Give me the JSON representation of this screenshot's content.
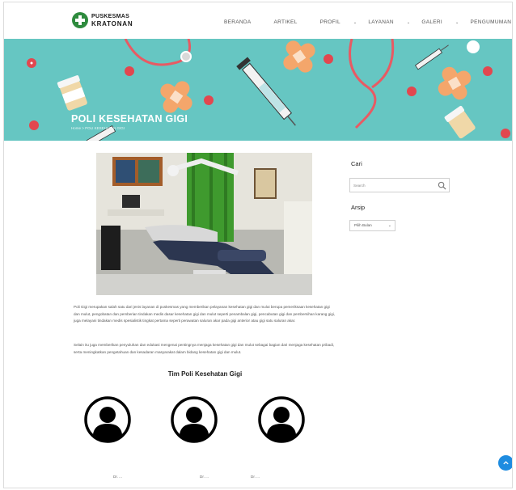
{
  "brand": {
    "line1": "PUSKESMAS",
    "line2": "KRATONAN"
  },
  "nav": {
    "items": [
      {
        "label": "BERANDA",
        "dropdown": false
      },
      {
        "label": "ARTIKEL",
        "dropdown": false
      },
      {
        "label": "PROFIL",
        "dropdown": true
      },
      {
        "label": "LAYANAN",
        "dropdown": true
      },
      {
        "label": "GALERI",
        "dropdown": true
      },
      {
        "label": "PENGUMUMAN",
        "dropdown": false
      }
    ],
    "caret": "⌄"
  },
  "banner": {
    "title": "POLI KESEHATAN GIGI",
    "breadcrumb": "Home  >  POLI KESEHATAN GIGI"
  },
  "article": {
    "paragraph1": "Poli Gigi merupakan salah satu dari jenis layanan di puskesmas yang memberikan pelayanan kesehatan gigi dan mulut berupa pemeriksaan kesehatan gigi dan mulut, pengobatan dan pemberian tindakan medis dasar kesehatan gigi dan mulut seperti penambalan gigi, pencabutan gigi dan pembersihan karang gigi, juga melayani tindakan medis spesialistik tingkat pertama seperti perawatan saluran akar pada gigi anterior atau gigi satu saluran akar.",
    "paragraph2": "Selain itu juga memberikan penyuluhan dan edukasi mengenai pentingnya menjaga kesehatan gigi dan mulut sebagai bagian dari menjaga kesehatan pribadi, serta meningkatkan pengetahuan dan kesadaran masyarakat dalam bidang kesehatan gigi dan mulut.",
    "team_title": "Tim Poli Kesehatan Gigi",
    "members": [
      {
        "name": "Dr. ..."
      },
      {
        "name": "Dr. ..."
      },
      {
        "name": "Dr. ..."
      }
    ]
  },
  "sidebar": {
    "search_heading": "Cari",
    "search_placeholder": "Search",
    "archive_heading": "Arsip",
    "archive_select": "Pilih Bulan"
  },
  "colors": {
    "banner": "#66c6c2",
    "accent_green": "#2e8b3e",
    "fab": "#1e8ce0"
  },
  "icons": {
    "search": "search-icon",
    "scroll_top": "arrow-up-icon",
    "avatar": "user-avatar-icon"
  }
}
